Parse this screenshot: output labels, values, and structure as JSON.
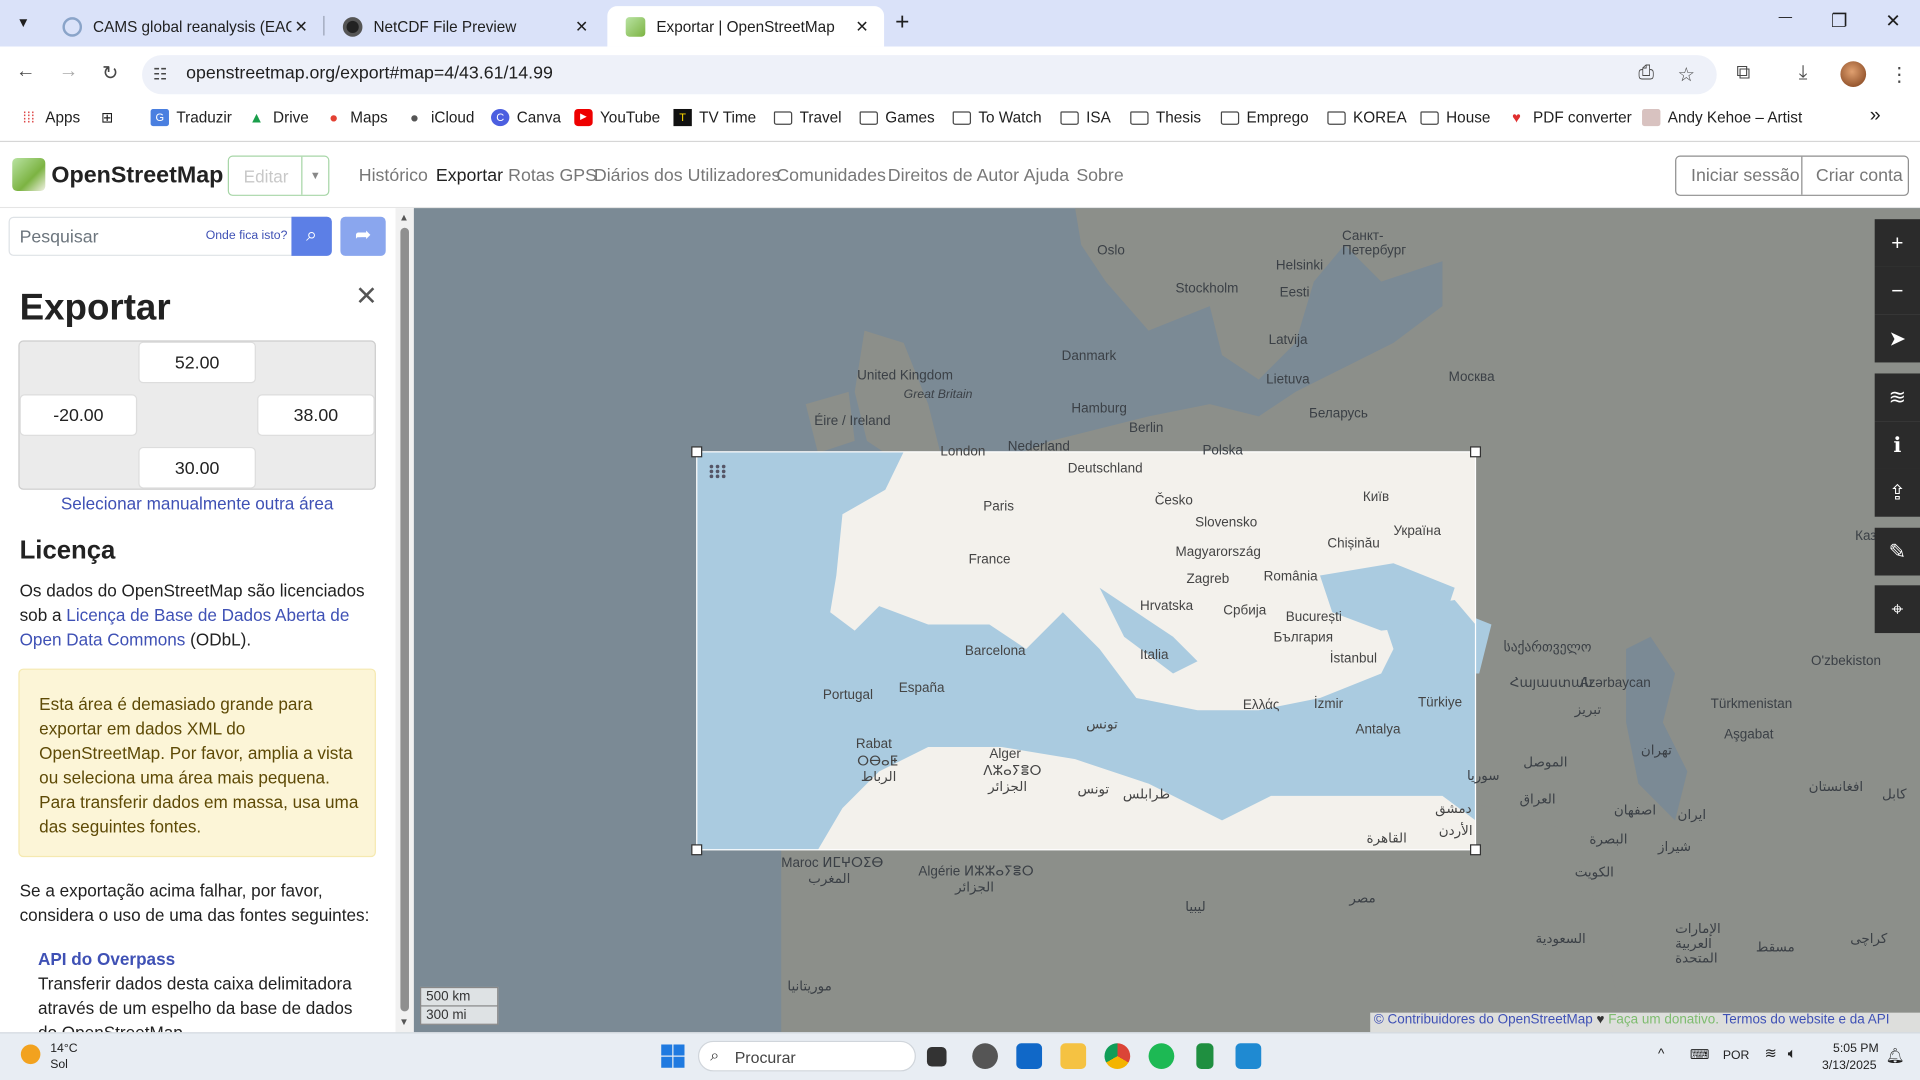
{
  "tabs": [
    {
      "title": "CAMS global reanalysis (EAC4)",
      "active": false
    },
    {
      "title": "NetCDF File Preview",
      "active": false
    },
    {
      "title": "Exportar | OpenStreetMap",
      "active": true
    }
  ],
  "new_tab": "+",
  "window": {
    "minimize": "—",
    "restore": "❐",
    "close": "✕"
  },
  "url": "openstreetmap.org/export#map=4/43.61/14.99",
  "bookmarks": {
    "apps": "Apps",
    "traduzir": "Traduzir",
    "drive": "Drive",
    "maps": "Maps",
    "icloud": "iCloud",
    "canva": "Canva",
    "youtube": "YouTube",
    "tvtime": "TV Time",
    "travel": "Travel",
    "games": "Games",
    "towatch": "To Watch",
    "isa": "ISA",
    "thesis": "Thesis",
    "emprego": "Emprego",
    "korea": "KOREA",
    "house": "House",
    "pdf": "PDF converter",
    "andy": "Andy Kehoe – Artist",
    "more": "»"
  },
  "osm": {
    "brand": "OpenStreetMap",
    "edit": "Editar",
    "nav": {
      "historico": "Histórico",
      "exportar": "Exportar",
      "rotas": "Rotas GPS",
      "diarios": "Diários dos Utilizadores",
      "comunidades": "Comunidades",
      "direitos": "Direitos de Autor",
      "ajuda": "Ajuda",
      "sobre": "Sobre"
    },
    "login": "Iniciar sessão",
    "signup": "Criar conta"
  },
  "search": {
    "placeholder": "Pesquisar",
    "where": "Onde fica isto?"
  },
  "export": {
    "title": "Exportar",
    "top": "52.00",
    "left": "-20.00",
    "right": "38.00",
    "bottom": "30.00",
    "manual_link": "Selecionar manualmente outra área",
    "license_heading": "Licença",
    "license_pre": "Os dados do OpenStreetMap são licenciados sob a ",
    "license_link": "Licença de Base de Dados Aberta de Open Data Commons",
    "license_post": " (ODbL).",
    "warning": "Esta área é demasiado grande para exportar em dados XML do OpenStreetMap. Por favor, amplia a vista ou seleciona uma área mais pequena. Para transferir dados em massa, usa uma das seguintes fontes.",
    "fallback": "Se a exportação acima falhar, por favor, considera o uso de uma das fontes seguintes:",
    "overpass_title": "API do Overpass",
    "overpass_desc": "Transferir dados desta caixa delimitadora através de um espelho da base de dados do OpenStreetMap"
  },
  "map": {
    "labels": {
      "oslo": "Oslo",
      "helsinki": "Helsinki",
      "stpete": "Санкт-Петербург",
      "stockholm": "Stockholm",
      "eesti": "Eesti",
      "uk": "United Kingdom",
      "gb": "Great Britain",
      "danmark": "Danmark",
      "latvija": "Latvija",
      "moskva": "Москва",
      "lietuva": "Lietuva",
      "eire": "Éire / Ireland",
      "hamburg": "Hamburg",
      "berlin": "Berlin",
      "belarus": "Беларусь",
      "london": "London",
      "nederland": "Nederland",
      "polska": "Polska",
      "deutschland": "Deutschland",
      "paris": "Paris",
      "cesko": "Česko",
      "kyiv": "Київ",
      "ukraina": "Україна",
      "slovensko": "Slovensko",
      "chisinau": "Chișinău",
      "france": "France",
      "magyar": "Magyarország",
      "zagreb": "Zagreb",
      "romania": "România",
      "hrvatska": "Hrvatska",
      "srbija": "Србија",
      "bucuresti": "București",
      "bulgaria": "България",
      "kazakh": "Казақстан",
      "barcelona": "Barcelona",
      "italia": "Italia",
      "georgia": "საქართველო",
      "istanbul": "İstanbul",
      "ozbek": "O'zbekiston",
      "portugal": "Portugal",
      "espana": "España",
      "armenia": "Հայաստան",
      "azer": "Azərbaycan",
      "tabriz": "تبریز",
      "ellas": "Ελλάς",
      "izmir": "İzmir",
      "turkiye": "Türkiye",
      "turkmen": "Türkmenistan",
      "ashgabat": "Aşgabat",
      "tunis": "تونس",
      "antalya": "Antalya",
      "syria": "سوريا",
      "tehran": "تهران",
      "rabat": "Rabat",
      "rabat2": "ⵔⴱⴰⵟ",
      "rabat3": "الرباط",
      "alger": "Alger",
      "alger2": "ⴷⵣⴰⵢⴻⵔ",
      "alger3": "الجزائر",
      "mosul": "الموصل",
      "tunis2": "تونس",
      "tripoli": "طرابلس",
      "damascus": "دمشق",
      "iraq": "العراق",
      "isfahan": "اصفهان",
      "iran": "ایران",
      "afghan": "افغانستان",
      "kabul": "کابل",
      "jordan": "الأردن",
      "cairo": "القاهرة",
      "morocco": "Maroc ⵍⵎⵖⵔⵉⴱ",
      "morocco2": "المغرب",
      "algeria": "Algérie ⵍⵣⵣⴰⵢⴻⵔ",
      "algeria2": "الجزائر",
      "basra": "البصرة",
      "shiraz": "شیراز",
      "libya": "ليبيا",
      "masr": "مصر",
      "kuwait": "الكويت",
      "saudi": "السعودية",
      "uae": "الإمارات العربية المتحدة",
      "muscat": "مسقط",
      "karachi": "کراچی",
      "mauritania": "موريتانيا"
    },
    "scale_km": "500 km",
    "scale_mi": "300 mi",
    "attribution": {
      "contributors": "© Contribuidores do OpenStreetMap",
      "donate": "Faça um donativo.",
      "terms": "Termos do website e da API"
    }
  },
  "taskbar": {
    "temp": "14°C",
    "cond": "Sol",
    "search": "Procurar",
    "lang": "POR",
    "time": "5:05 PM",
    "date": "3/13/2025"
  }
}
